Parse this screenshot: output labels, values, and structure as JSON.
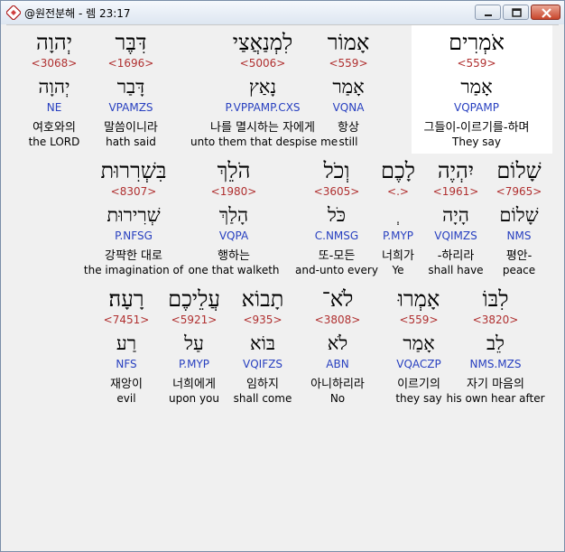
{
  "window": {
    "title": "@원전분해 - 렘 23:17"
  },
  "rows": [
    [
      {
        "top": "אֹמְרִים",
        "strong": "<559>",
        "lemma": "אָמַר",
        "morph": "VQPAMP",
        "kor": "그들이-이르기를-하며",
        "eng": "They say"
      },
      {
        "top": "אָמוֹר",
        "strong": "<559>",
        "lemma": "אָמַר",
        "morph": "VQNA",
        "kor": "항상",
        "eng": "still"
      },
      {
        "top": "לִמְנַאֲצַי",
        "strong": "<5006>",
        "lemma": "נָאַץ",
        "morph": "P.VPPAMP.CXS",
        "kor": "나를 멸시하는 자에게",
        "eng": "unto them that despise me"
      },
      {
        "top": "דִּבֶּר",
        "strong": "<1696>",
        "lemma": "דָּבַר",
        "morph": "VPAMZS",
        "kor": "말씀이니라",
        "eng": "hath said"
      },
      {
        "top": "יְהוָה",
        "strong": "<3068>",
        "lemma": "יְהוָה",
        "morph": "NE",
        "kor": "여호와의",
        "eng": "the LORD"
      }
    ],
    [
      {
        "top": "שָׁלוֹם",
        "strong": "<7965>",
        "lemma": "שָׁלוֹם",
        "morph": "NMS",
        "kor": "평안-",
        "eng": "peace"
      },
      {
        "top": "יִהְיֶה",
        "strong": "<1961>",
        "lemma": "הָיָה",
        "morph": "VQIMZS",
        "kor": "-하리라",
        "eng": "shall have"
      },
      {
        "top": "לָכֶם",
        "strong": "<.>",
        "lemma": "ְ",
        "morph": "P.MYP",
        "kor": "너희가",
        "eng": "Ye"
      },
      {
        "top": "וְכֹל",
        "strong": "<3605>",
        "lemma": "כֹּל",
        "morph": "C.NMSG",
        "kor": "또-모든",
        "eng": "and-unto every"
      },
      {
        "top": "הֹלֵךְ",
        "strong": "<1980>",
        "lemma": "הָלַךְ",
        "morph": "VQPA",
        "kor": "행하는",
        "eng": "one that walketh"
      },
      {
        "top": "בִּשְׁרִרוּת",
        "strong": "<8307>",
        "lemma": "שְׁרִירוּת",
        "morph": "P.NFSG",
        "kor": "강퍅한 대로",
        "eng": "the imagination of"
      }
    ],
    [
      {
        "top": "לִבּוֹ",
        "strong": "<3820>",
        "lemma": "לֵב",
        "morph": "NMS.MZS",
        "kor": "자기 마음의",
        "eng": "his own hear after"
      },
      {
        "top": "אָמְרוּ",
        "strong": "<559>",
        "lemma": "אָמַר",
        "morph": "VQACZP",
        "kor": "이르기의",
        "eng": "they say"
      },
      {
        "top": "לֹא־",
        "strong": "<3808>",
        "lemma": "לֹא",
        "morph": "ABN",
        "kor": "아니하리라",
        "eng": "No"
      },
      {
        "top": "תָבוֹא",
        "strong": "<935>",
        "lemma": "בּוֹא",
        "morph": "VQIFZS",
        "kor": "임하지",
        "eng": "shall come"
      },
      {
        "top": "עֲלֵיכֶם",
        "strong": "<5921>",
        "lemma": "עַל",
        "morph": "P.MYP",
        "kor": "너희에게",
        "eng": "upon you"
      },
      {
        "top": "רָעָה׃",
        "strong": "<7451>",
        "lemma": "רַע",
        "morph": "NFS",
        "kor": "재앙이",
        "eng": "evil"
      }
    ]
  ]
}
